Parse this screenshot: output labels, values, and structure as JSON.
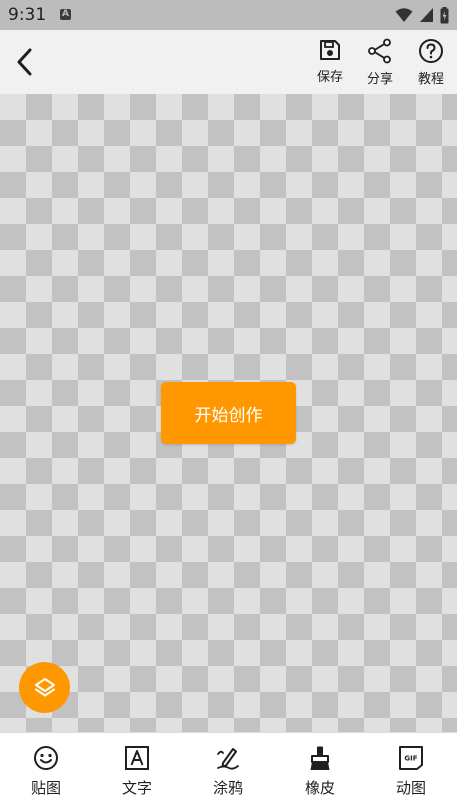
{
  "status_bar": {
    "time": "9:31",
    "notification_icon_letter": "A",
    "icons": [
      "wifi-icon",
      "signal-icon",
      "battery-icon"
    ]
  },
  "toolbar": {
    "back_icon": "chevron-left-icon",
    "actions": [
      {
        "label": "保存",
        "icon": "save-icon"
      },
      {
        "label": "分享",
        "icon": "share-icon"
      },
      {
        "label": "教程",
        "icon": "help-icon"
      }
    ]
  },
  "canvas": {
    "start_button_label": "开始创作",
    "layers_icon": "layers-icon"
  },
  "bottom_toolbar": {
    "tools": [
      {
        "label": "贴图",
        "icon": "sticker-smile-icon"
      },
      {
        "label": "文字",
        "icon": "text-icon"
      },
      {
        "label": "涂鸦",
        "icon": "doodle-pen-icon"
      },
      {
        "label": "橡皮",
        "icon": "eraser-brush-icon"
      },
      {
        "label": "动图",
        "icon": "gif-icon"
      }
    ]
  },
  "colors": {
    "accent": "#ff9800",
    "status_bar_bg": "#bcbcbc",
    "toolbar_bg": "#f1f1f1",
    "checker_light": "#e0e0e0",
    "checker_dark": "#c2c2c2"
  }
}
